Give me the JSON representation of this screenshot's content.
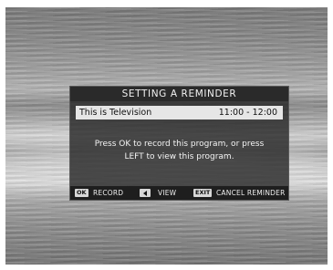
{
  "dialog": {
    "title": "SETTING A REMINDER",
    "program": {
      "name": "This is Television",
      "time": "11:00 - 12:00"
    },
    "message_line1": "Press OK to record this program, or press",
    "message_line2": "LEFT to view this program."
  },
  "footer": {
    "ok_key": "OK",
    "record_label": "RECORD",
    "left_key_icon": "left-triangle-icon",
    "view_label": "VIEW",
    "exit_key": "EXIT",
    "cancel_label": "CANCEL REMINDER"
  }
}
